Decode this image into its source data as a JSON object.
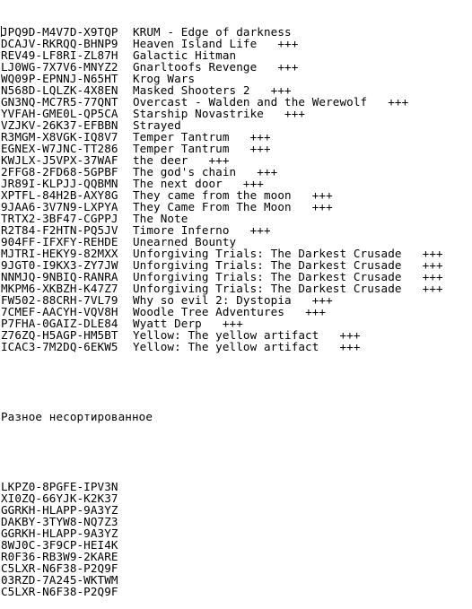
{
  "document": {
    "entries": [
      {
        "key": "JPQ9D-M4V7D-X9TQP",
        "title": "KRUM - Edge of darkness",
        "mark": ""
      },
      {
        "key": "DCAJV-RKRQQ-BHNP9",
        "title": "Heaven Island Life",
        "mark": "+++"
      },
      {
        "key": "REV49-LF8RI-ZL87H",
        "title": "Galactic Hitman",
        "mark": ""
      },
      {
        "key": "LJ0WG-7X7V6-MNYZ2",
        "title": "Gnarltoofs Revenge",
        "mark": "+++"
      },
      {
        "key": "WQ09P-EPNNJ-N65HT",
        "title": "Krog Wars",
        "mark": ""
      },
      {
        "key": "N568D-LQLZK-4X8EN",
        "title": "Masked Shooters 2",
        "mark": "+++"
      },
      {
        "key": "GN3NQ-MC7R5-77QNT",
        "title": "Overcast - Walden and the Werewolf",
        "mark": "+++"
      },
      {
        "key": "YVFAH-GME0L-QP5CA",
        "title": "Starship Novastrike",
        "mark": "+++"
      },
      {
        "key": "VZJKV-26K37-EFBBN",
        "title": "Strayed",
        "mark": ""
      },
      {
        "key": "R3MGM-X8VGK-IQ8V7",
        "title": "Temper Tantrum",
        "mark": "+++"
      },
      {
        "key": "EGNEX-W7JNC-TT286",
        "title": "Temper Tantrum",
        "mark": "+++"
      },
      {
        "key": "KWJLX-J5VPX-37WAF",
        "title": "the deer",
        "mark": "+++"
      },
      {
        "key": "2FFG8-2FD68-5GPBF",
        "title": "The god's chain",
        "mark": "+++"
      },
      {
        "key": "JR89I-KLPJJ-QQBMN",
        "title": "The next door",
        "mark": "+++"
      },
      {
        "key": "XPTFL-84H2B-AXY8G",
        "title": "They came from the moon",
        "mark": "+++"
      },
      {
        "key": "9JAA6-3V7N9-LXPYA",
        "title": "They Came From The Moon",
        "mark": "+++"
      },
      {
        "key": "TRTX2-3BF47-CGPPJ",
        "title": "The Note",
        "mark": ""
      },
      {
        "key": "R2T84-F2HTN-PQ5JV",
        "title": "Timore Inferno",
        "mark": "+++"
      },
      {
        "key": "904FF-IFXFY-REHDE",
        "title": "Unearned Bounty",
        "mark": ""
      },
      {
        "key": "MJTRI-HEKY9-82MXX",
        "title": "Unforgiving Trials: The Darkest Crusade",
        "mark": "+++"
      },
      {
        "key": "9JGT0-I9KX3-ZY7JW",
        "title": "Unforgiving Trials: The Darkest Crusade",
        "mark": "+++"
      },
      {
        "key": "NNMJQ-9NBIQ-RANRA",
        "title": "Unforgiving Trials: The Darkest Crusade",
        "mark": "+++"
      },
      {
        "key": "MKPM6-XKBZH-K47Z7",
        "title": "Unforgiving Trials: The Darkest Crusade",
        "mark": "+++"
      },
      {
        "key": "FW502-88CRH-7VL79",
        "title": "Why so evil 2: Dystopia",
        "mark": "+++"
      },
      {
        "key": "7CMEF-AACYH-VQV8H",
        "title": "Woodle Tree Adventures",
        "mark": "+++"
      },
      {
        "key": "P7FHA-0GAIZ-DLE84",
        "title": "Wyatt Derp",
        "mark": "+++"
      },
      {
        "key": "Z76ZQ-H5AGP-HM5BT",
        "title": "Yellow: The yellow artifact",
        "mark": "+++"
      },
      {
        "key": "ICAC3-7M2DQ-6EKW5",
        "title": "Yellow: The yellow artifact",
        "mark": "+++"
      }
    ],
    "section_heading": "Разное несортированное",
    "unsorted_keys": [
      "LKPZ0-8PGFE-IPV3N",
      "XI0ZQ-66YJK-K2K37",
      "GGRKH-HLAPP-9A3YZ",
      "DAKBY-3TYW8-NQ7Z3",
      "GGRKH-HLAPP-9A3YZ",
      "8WJ0C-3F9CP-HEI4K",
      "R0F36-RB3W9-2KARE",
      "C5LXR-N6F38-P2Q9F",
      "03RZD-7A245-WKTWM",
      "C5LXR-N6F38-P2Q9F"
    ]
  }
}
